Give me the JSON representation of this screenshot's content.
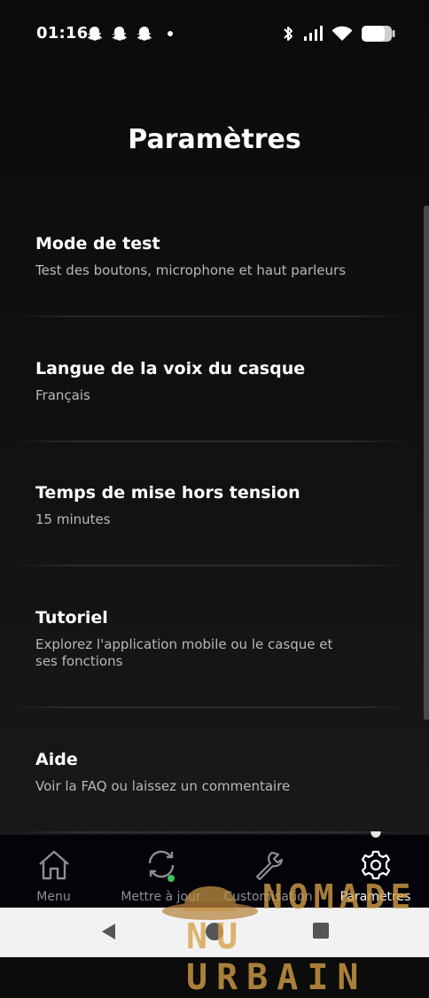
{
  "status_bar": {
    "time": "01:16",
    "left_icons": [
      "snapchat-ghost-icon",
      "snapchat-ghost-icon",
      "snapchat-ghost-icon",
      "dot-icon"
    ],
    "right_icons": [
      "bluetooth-icon",
      "signal-icon",
      "wifi-icon",
      "battery-icon"
    ]
  },
  "page": {
    "title": "Paramètres"
  },
  "settings": [
    {
      "title": "Mode de test",
      "subtitle": "Test des boutons, microphone et haut parleurs"
    },
    {
      "title": "Langue de la voix du casque",
      "subtitle": "Français"
    },
    {
      "title": "Temps de mise hors tension",
      "subtitle": "15 minutes"
    },
    {
      "title": "Tutoriel",
      "subtitle": "Explorez l'application mobile ou le casque et ses fonctions"
    },
    {
      "title": "Aide",
      "subtitle": "Voir la FAQ ou laissez un commentaire"
    }
  ],
  "bottom_nav": {
    "items": [
      {
        "label": "Menu",
        "icon": "home-icon"
      },
      {
        "label": "Mettre à jour",
        "icon": "sync-icon"
      },
      {
        "label": "Customisation",
        "icon": "wrench-icon"
      },
      {
        "label": "Paramètres",
        "icon": "gear-icon"
      }
    ],
    "active_index": 3
  },
  "watermark": {
    "line1": "NOMADE",
    "line2": "NU URBAIN"
  },
  "system_nav": {
    "buttons": [
      "back-icon",
      "home-circle-icon",
      "recents-icon"
    ]
  },
  "colors": {
    "background": "#0c0c0c",
    "nav_background": "#030309",
    "subtitle": "#b8b8bc",
    "update_badge": "#3ec45a",
    "watermark": "#d6a046"
  }
}
